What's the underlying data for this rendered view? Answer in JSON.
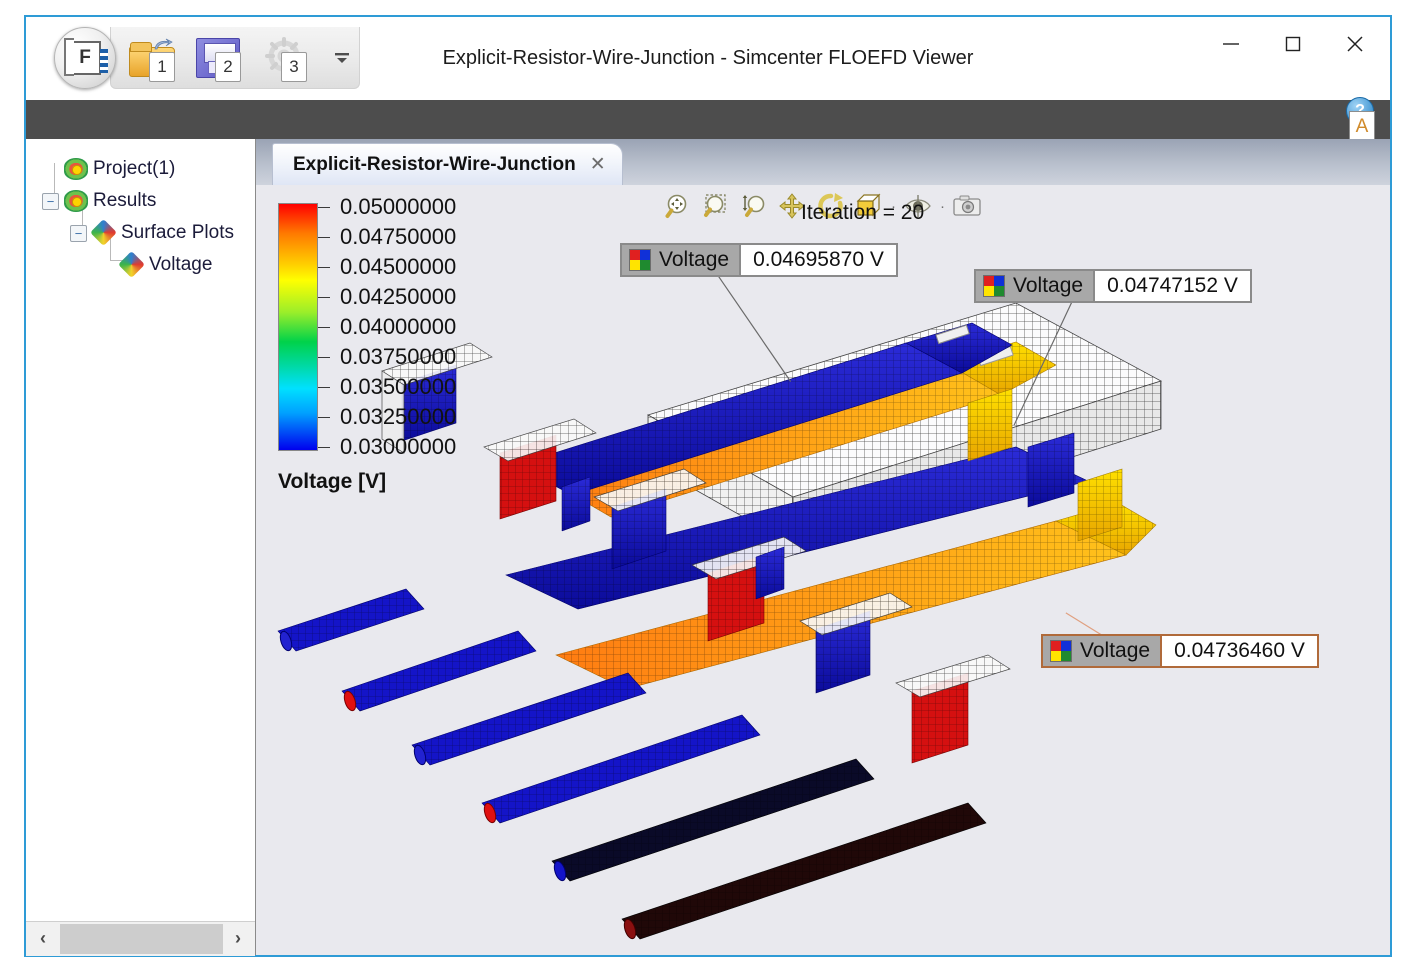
{
  "window": {
    "title": "Explicit-Resistor-Wire-Junction - Simcenter FLOEFD Viewer",
    "app_badge": "F",
    "minimize": "─",
    "maximize": "□",
    "close": "✕",
    "quick_access": [
      {
        "name": "open-file-button",
        "icon": "folder-open-icon",
        "badge": "1"
      },
      {
        "name": "save-button",
        "icon": "save-disk-icon",
        "badge": "2"
      },
      {
        "name": "settings-button",
        "icon": "gear-icon",
        "badge": "3"
      }
    ],
    "quick_access_more": "═"
  },
  "help_widget": {
    "help_glyph": "?",
    "annotation_glyph": "A"
  },
  "sidebar": {
    "tree": [
      {
        "label": "Project(1)",
        "icon": "project-icon",
        "depth": 0,
        "expander": ""
      },
      {
        "label": "Results",
        "icon": "results-icon",
        "depth": 0,
        "expander": "−"
      },
      {
        "label": "Surface Plots",
        "icon": "surface-plot-icon",
        "depth": 1,
        "expander": "−"
      },
      {
        "label": "Voltage",
        "icon": "surface-plot-icon",
        "depth": 2,
        "expander": ""
      }
    ],
    "scrollbar": {
      "left_arrow": "‹",
      "right_arrow": "›"
    }
  },
  "viewer": {
    "tab": {
      "label": "Explicit-Resistor-Wire-Junction",
      "close": "✕"
    },
    "toolbar": [
      {
        "name": "zoom-fit-icon",
        "glyph": "zoom-fit"
      },
      {
        "name": "zoom-window-icon",
        "glyph": "zoom-window"
      },
      {
        "name": "zoom-in-out-icon",
        "glyph": "zoom-scale"
      },
      {
        "name": "pan-icon",
        "glyph": "pan"
      },
      {
        "name": "rotate-icon",
        "glyph": "rotate"
      },
      {
        "name": "view-orientation-icon",
        "glyph": "cube"
      },
      {
        "name": "view-orientation-dropdown",
        "glyph": "·"
      },
      {
        "name": "visibility-icon",
        "glyph": "eye"
      },
      {
        "name": "visibility-dropdown",
        "glyph": "·"
      },
      {
        "name": "snapshot-icon",
        "glyph": "camera"
      }
    ],
    "iteration_text": "Iteration = 20",
    "legend": {
      "unit_label": "Voltage [V]",
      "labels": [
        "0.05000000",
        "0.04750000",
        "0.04500000",
        "0.04250000",
        "0.04000000",
        "0.03750000",
        "0.03500000",
        "0.03250000",
        "0.03000000"
      ],
      "max": 0.05,
      "min": 0.03,
      "color_top": "#ff0000",
      "color_bottom": "#0000ee"
    },
    "callouts": [
      {
        "name": "Voltage",
        "value": "0.04695870 V",
        "selected": false
      },
      {
        "name": "Voltage",
        "value": "0.04747152 V",
        "selected": false
      },
      {
        "name": "Voltage",
        "value": "0.04736460 V",
        "selected": true
      }
    ]
  },
  "colors": {
    "accent_border": "#2e9bd6",
    "ribbon": "#4d4d4d",
    "canvas_bg": "#e9e9ee",
    "selected_callout_border": "#b06a3a"
  }
}
